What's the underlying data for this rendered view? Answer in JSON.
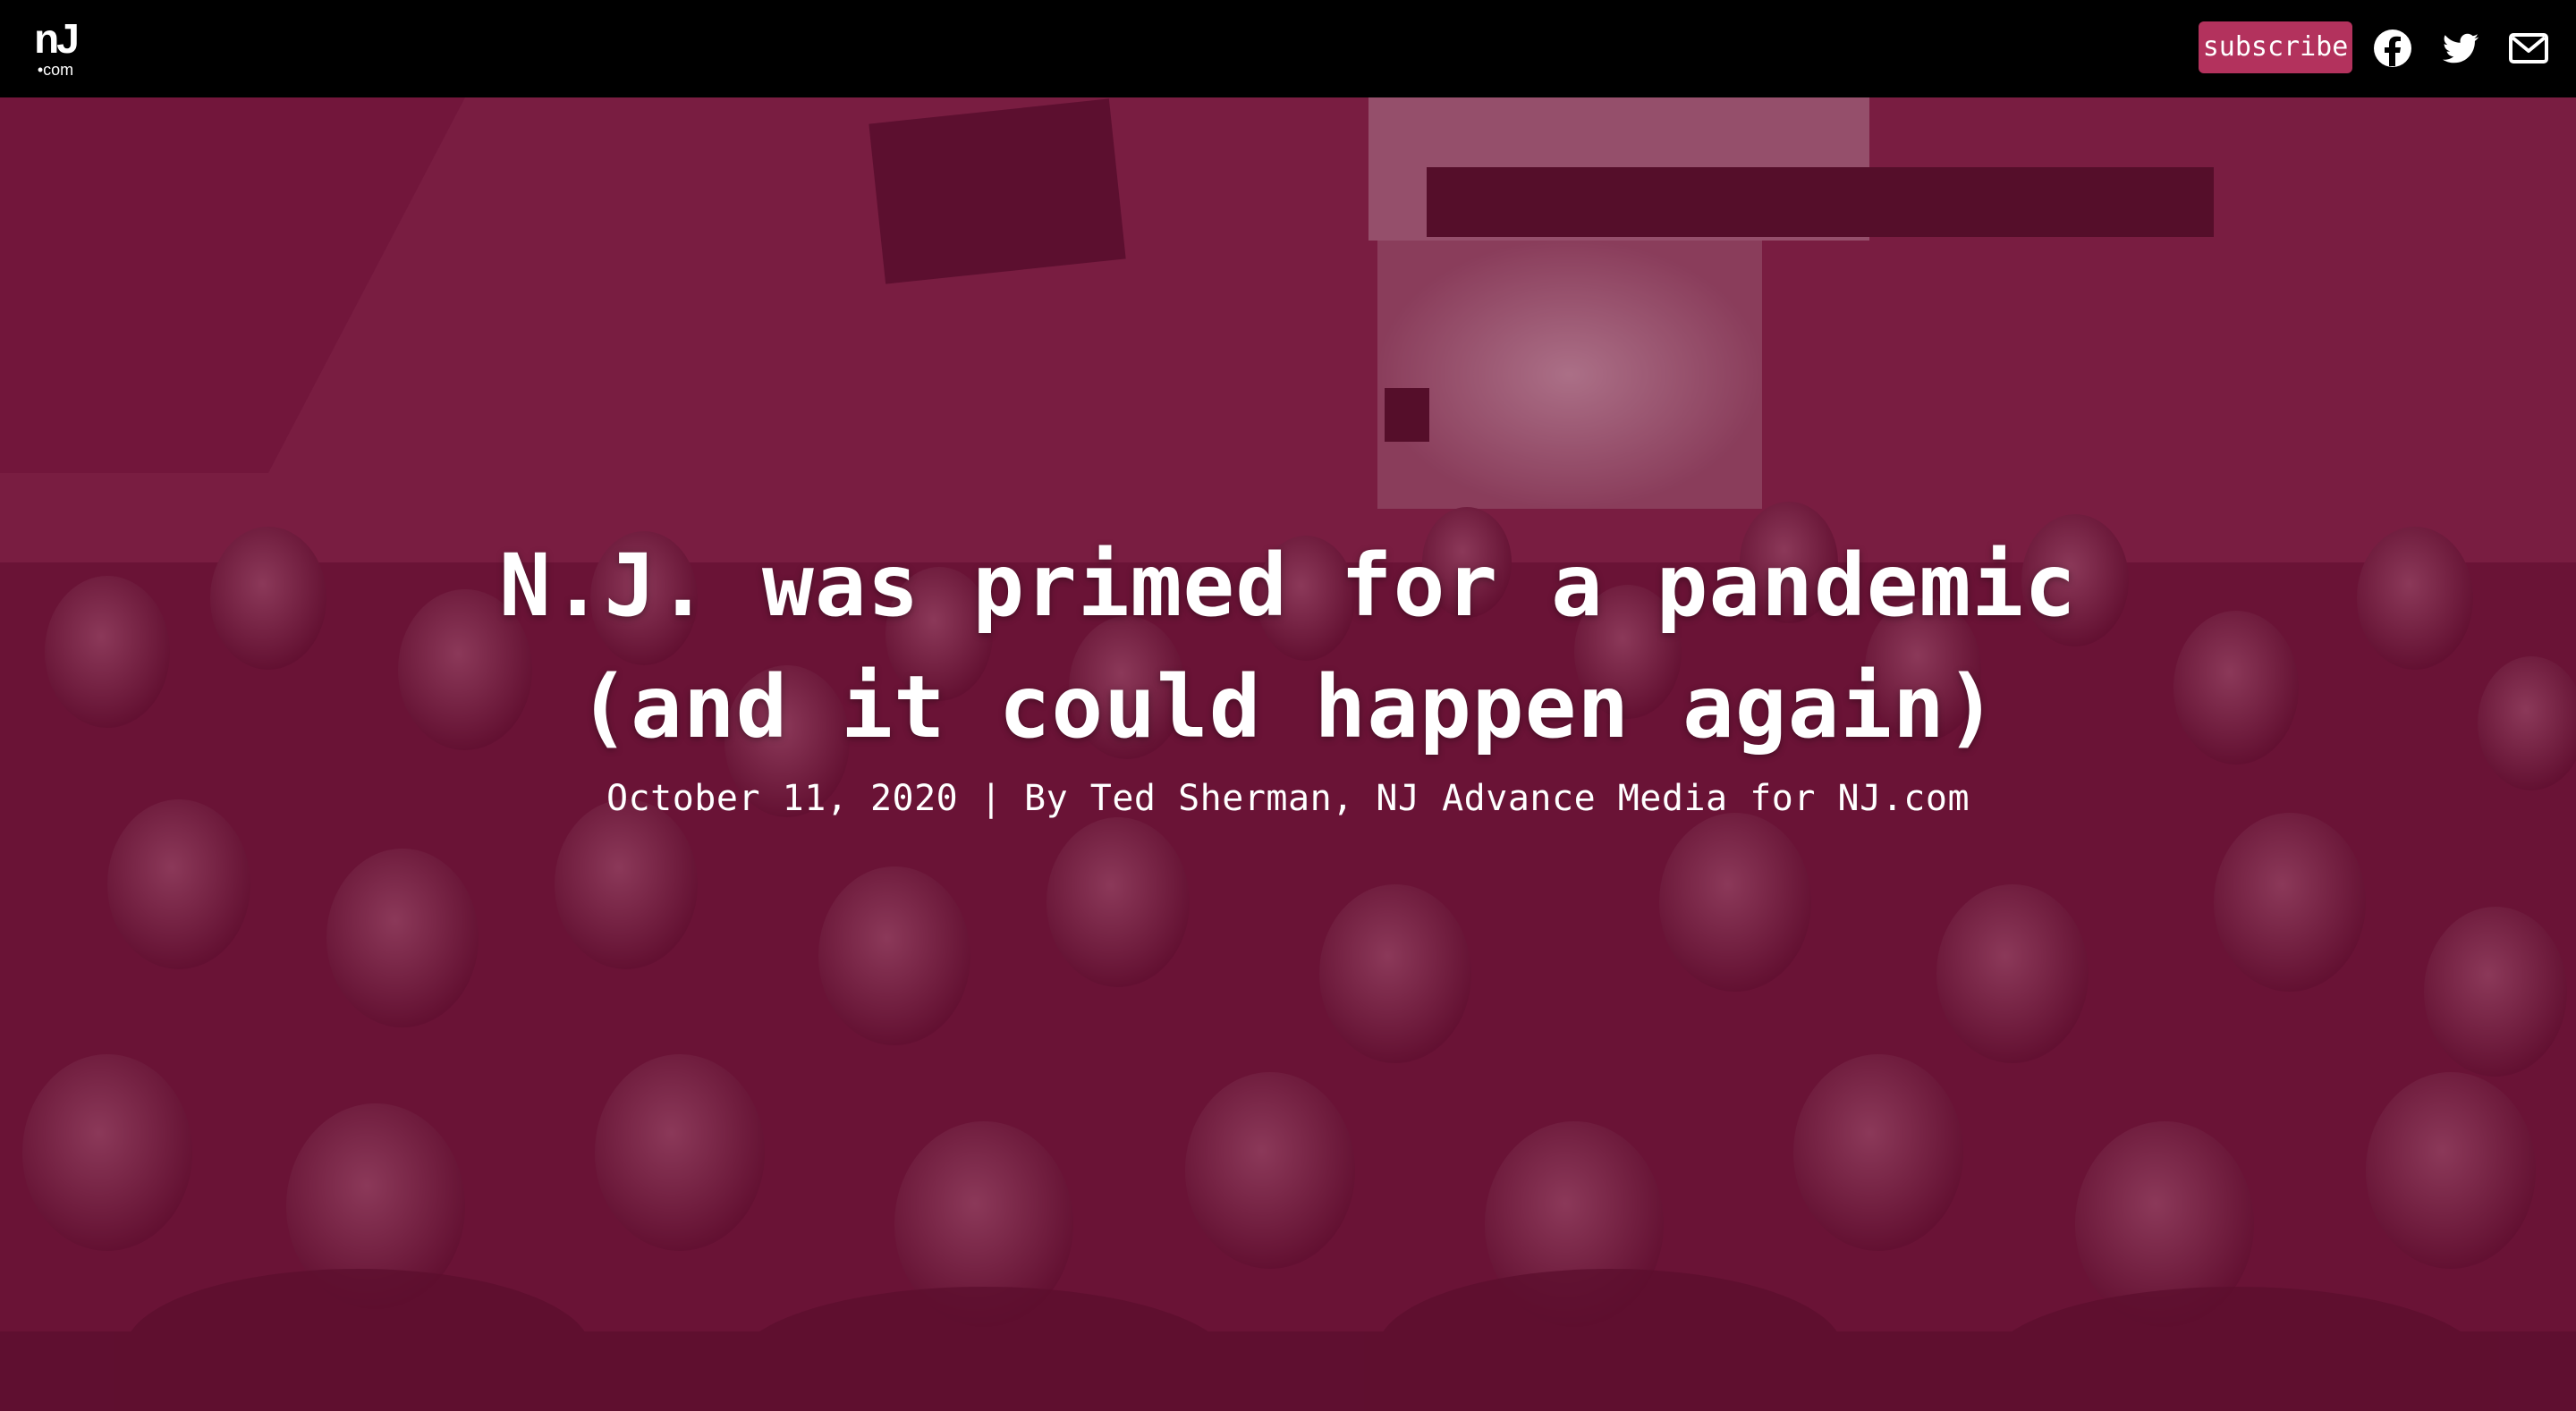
{
  "header": {
    "logo": {
      "mark": "nJ",
      "sub": "•com"
    },
    "subscribe_label": "subscribe",
    "social_icons": [
      "facebook-icon",
      "twitter-icon",
      "mail-icon"
    ]
  },
  "hero": {
    "headline_lines": [
      "N.J. was primed for a pandemic",
      "(and it could happen again)"
    ],
    "byline": "October 11, 2020 | By Ted Sherman, NJ Advance Media for NJ.com"
  },
  "colors": {
    "topbar": "#000000",
    "subscribe_bg": "#b3325d",
    "hero_tint": "#78123a",
    "text": "#ffffff"
  }
}
